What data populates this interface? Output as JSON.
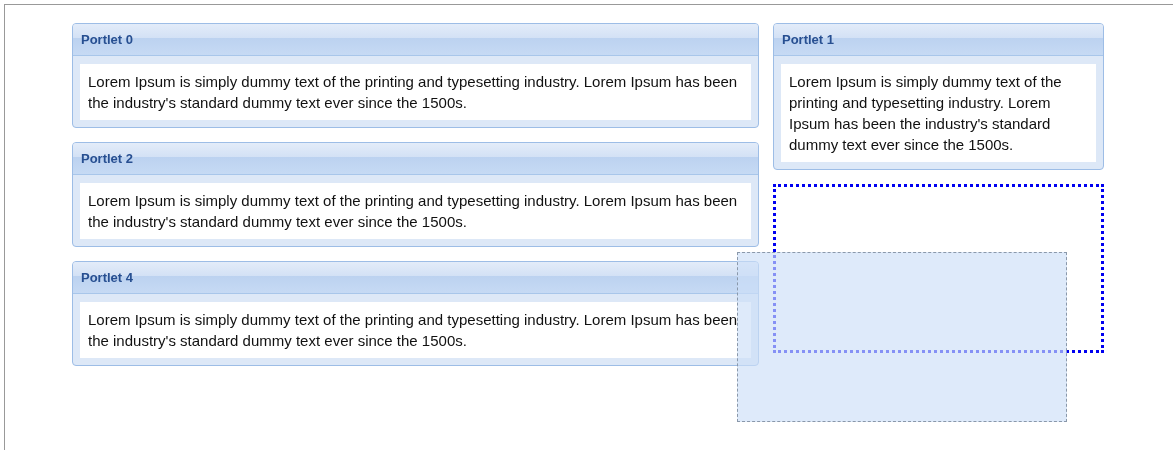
{
  "columns": [
    {
      "items": [
        {
          "kind": "portlet",
          "title": "Portlet 0",
          "text": "Lorem Ipsum is simply dummy text of the printing and typesetting industry. Lorem Ipsum has been the industry's standard dummy text ever since the 1500s."
        },
        {
          "kind": "portlet",
          "title": "Portlet 2",
          "text": "Lorem Ipsum is simply dummy text of the printing and typesetting industry. Lorem Ipsum has been the industry's standard dummy text ever since the 1500s."
        },
        {
          "kind": "portlet",
          "title": "Portlet 4",
          "text": "Lorem Ipsum is simply dummy text of the printing and typesetting industry. Lorem Ipsum has been the industry's standard dummy text ever since the 1500s."
        }
      ]
    },
    {
      "items": [
        {
          "kind": "portlet",
          "title": "Portlet 1",
          "text": "Lorem Ipsum is simply dummy text of the printing and typesetting industry. Lorem Ipsum has been the industry's standard dummy text ever since the 1500s."
        },
        {
          "kind": "placeholder"
        }
      ]
    }
  ],
  "drag_helper": {
    "kind": "ghost"
  }
}
